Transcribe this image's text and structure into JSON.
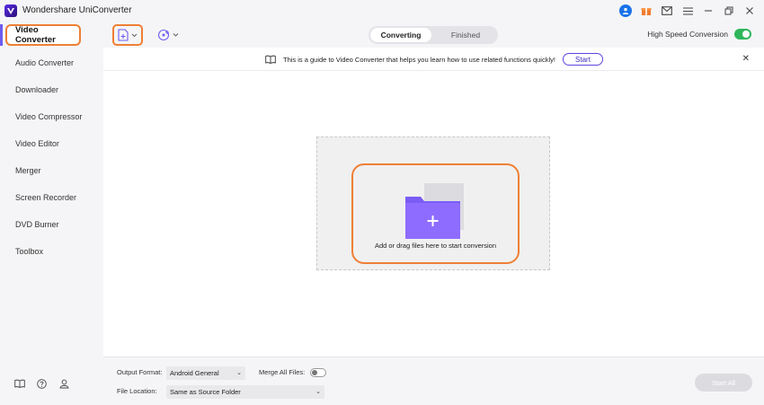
{
  "app": {
    "title": "Wondershare UniConverter"
  },
  "sidebar": {
    "items": [
      {
        "label": "Video Converter",
        "active": true
      },
      {
        "label": "Audio Converter"
      },
      {
        "label": "Downloader"
      },
      {
        "label": "Video Compressor"
      },
      {
        "label": "Video Editor"
      },
      {
        "label": "Merger"
      },
      {
        "label": "Screen Recorder"
      },
      {
        "label": "DVD Burner"
      },
      {
        "label": "Toolbox"
      }
    ],
    "bottom_icons": [
      "book-icon",
      "help-icon",
      "account-icon"
    ]
  },
  "toolbar": {
    "tabs": [
      {
        "label": "Converting",
        "active": true
      },
      {
        "label": "Finished"
      }
    ],
    "high_speed_label": "High Speed Conversion",
    "high_speed_on": true
  },
  "guide": {
    "text": "This is a guide to Video Converter that helps you learn how to use related functions quickly!",
    "start_label": "Start"
  },
  "dropzone": {
    "text": "Add or drag files here to start conversion"
  },
  "footer": {
    "output_format_label": "Output Format:",
    "output_format_value": "Android General",
    "merge_label": "Merge All Files:",
    "merge_on": false,
    "file_location_label": "File Location:",
    "file_location_value": "Same as Source Folder",
    "start_all_label": "Start All"
  },
  "colors": {
    "accent": "#ef7f36",
    "brand": "#6d5cf0",
    "toggle_on": "#2fb65b",
    "folder": "#7b5cf5"
  }
}
